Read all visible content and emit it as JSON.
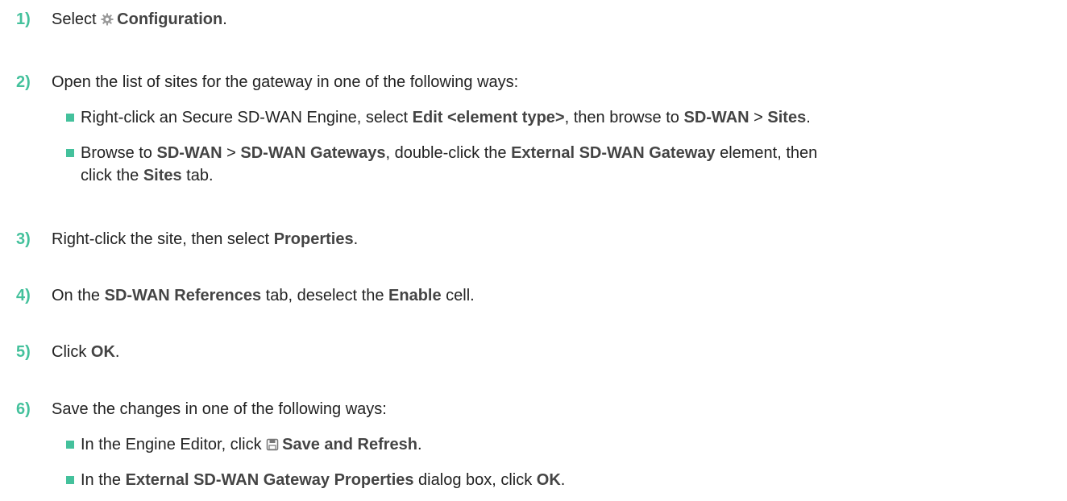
{
  "steps": [
    {
      "number": "1)",
      "parts": [
        "Select ",
        "",
        "Configuration",
        "."
      ],
      "icon": "gear-icon"
    },
    {
      "number": "2)",
      "text": "Open the list of sites for the gateway in one of the following ways:"
    },
    {
      "number": "3)",
      "parts": [
        "Right-click the site, then select ",
        "Properties",
        "."
      ]
    },
    {
      "number": "4)",
      "parts": [
        "On the ",
        "SD-WAN References",
        " tab, deselect the ",
        "Enable",
        " cell."
      ]
    },
    {
      "number": "5)",
      "parts": [
        "Click ",
        "OK",
        "."
      ]
    },
    {
      "number": "6)",
      "text": "Save the changes in one of the following ways:"
    }
  ],
  "step2_bullets": [
    {
      "parts": [
        "Right-click an Secure SD-WAN Engine, select ",
        "Edit <element type>",
        ", then browse to ",
        "SD-WAN",
        " > ",
        "Sites",
        "."
      ]
    },
    {
      "line1": [
        "Browse to ",
        "SD-WAN",
        " > ",
        "SD-WAN Gateways",
        ", double-click the ",
        "External SD-WAN Gateway",
        " element, then"
      ],
      "line2": [
        "click the ",
        "Sites",
        " tab."
      ]
    }
  ],
  "step6_bullets": [
    {
      "parts": [
        "In the Engine Editor, click ",
        "Save and Refresh",
        "."
      ],
      "icon": "save-icon"
    },
    {
      "parts": [
        "In the ",
        "External SD-WAN Gateway Properties",
        " dialog box, click ",
        "OK",
        "."
      ]
    }
  ],
  "colors": {
    "accent": "#44c19c",
    "text": "#222222",
    "ui_text": "#444444"
  }
}
